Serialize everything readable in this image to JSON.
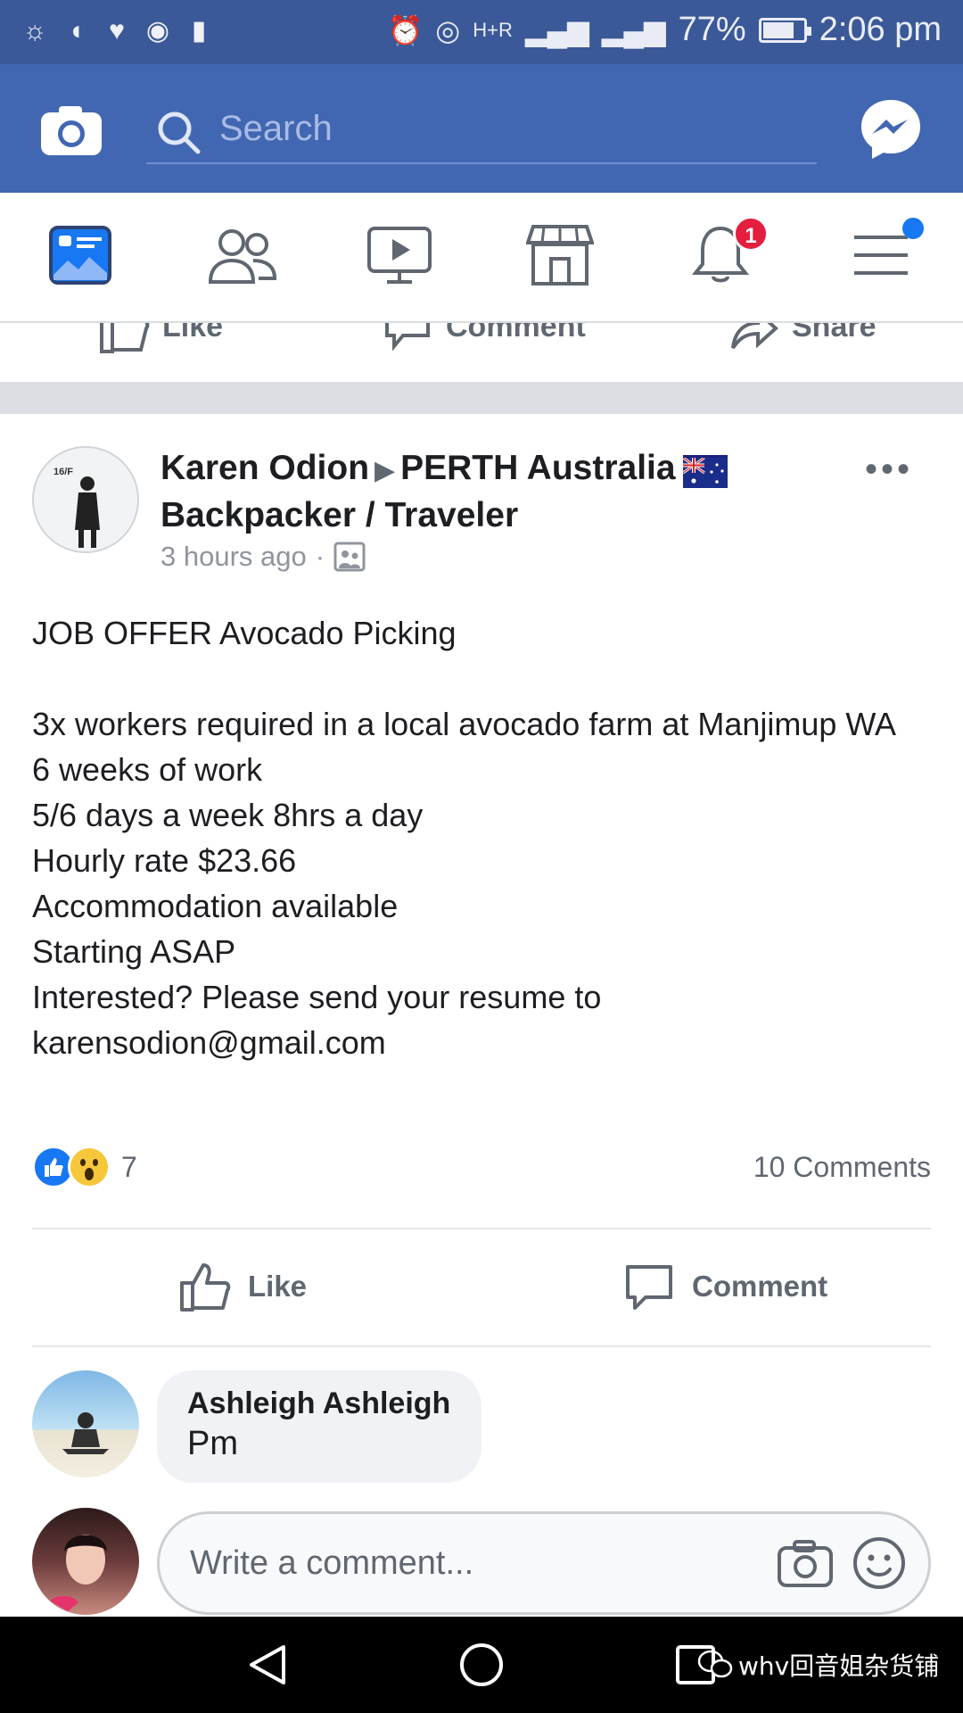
{
  "status_bar": {
    "battery_percent": "77%",
    "battery_level": 0.77,
    "time": "2:06 pm",
    "network_label": "H+R"
  },
  "header": {
    "search_placeholder": "Search"
  },
  "nav": {
    "notifications_badge": "1"
  },
  "previous_post_actions": {
    "like": "Like",
    "comment": "Comment",
    "share": "Share"
  },
  "post": {
    "author": "Karen Odion",
    "group": "PERTH Australia",
    "group_line2": "Backpacker / Traveler",
    "timestamp": "3 hours ago",
    "avatar_text": "16/F",
    "body_lines": [
      "JOB OFFER Avocado Picking",
      "",
      "3x workers required in a local avocado farm at Manjimup WA",
      "6 weeks of work",
      "5/6 days a week 8hrs a day",
      "Hourly rate $23.66",
      "Accommodation available",
      "Starting ASAP",
      "Interested? Please send your resume to karensodion@gmail.com"
    ],
    "reaction_count": "7",
    "comment_count": "10 Comments",
    "like_label": "Like",
    "comment_label": "Comment"
  },
  "comment": {
    "name": "Ashleigh Ashleigh",
    "text": "Pm"
  },
  "write_comment": {
    "placeholder": "Write a comment..."
  },
  "watermark": {
    "text": "whv回音姐杂货铺"
  },
  "colors": {
    "header_blue": "#4267b2",
    "status_blue": "#3b5998",
    "badge_red": "#e41e3f",
    "like_blue": "#1877f2"
  }
}
